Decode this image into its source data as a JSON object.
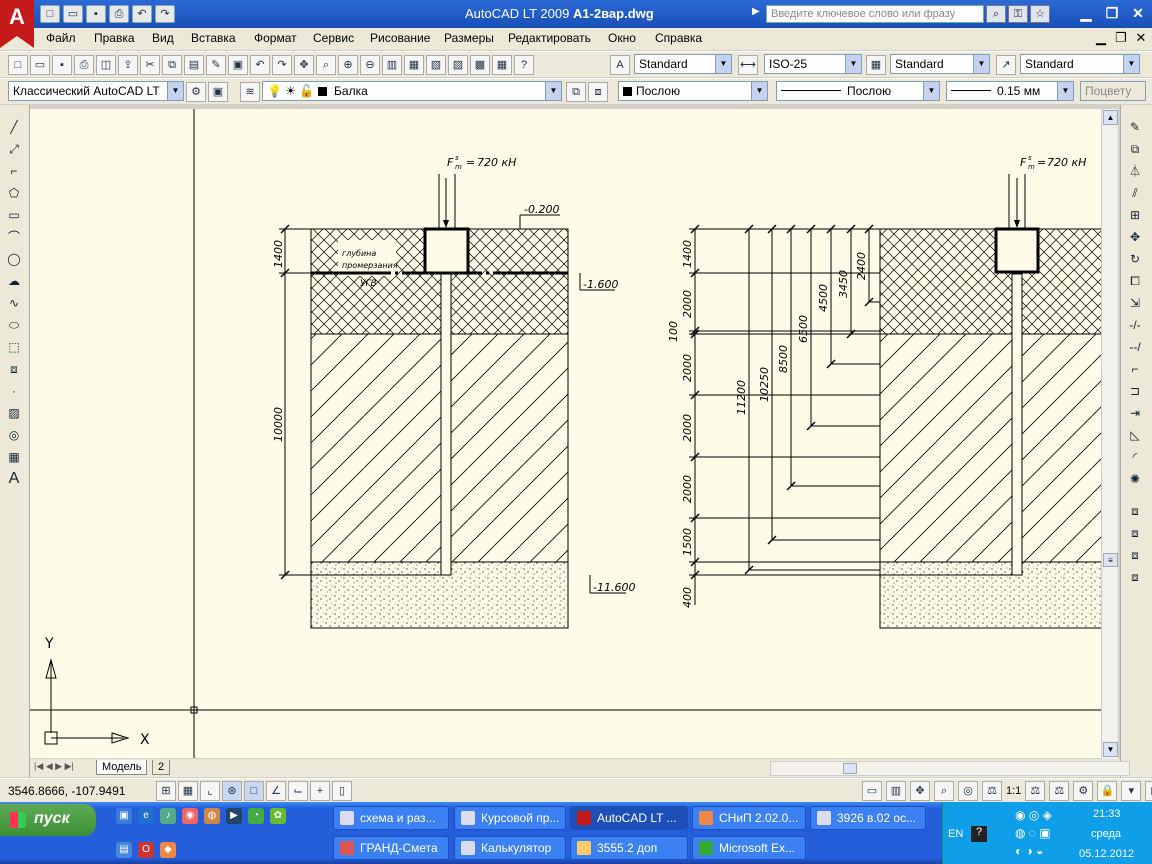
{
  "window": {
    "app_title": "AutoCAD LT 2009",
    "file_name": "A1-2вар.dwg",
    "search_placeholder": "Введите ключевое слово или фразу"
  },
  "menu": [
    "Файл",
    "Правка",
    "Вид",
    "Вставка",
    "Формат",
    "Сервис",
    "Рисование",
    "Размеры",
    "Редактировать",
    "Окно",
    "Справка"
  ],
  "styles_toolbar": {
    "text_style": "Standard",
    "dim_style": "ISO-25",
    "table_style": "Standard",
    "multileader_style": "Standard"
  },
  "layers_toolbar": {
    "workspace": "Классический AutoCAD LT",
    "layer": "Балка",
    "color": "Послою",
    "linetype": "Послою",
    "lineweight": "0.15 мм",
    "plot_style": "Поцвету"
  },
  "drawing": {
    "load_label_left": "720 кН",
    "load_label_right": "720 кН",
    "load_symbol": "F",
    "load_super": "s",
    "load_sub": "m",
    "elev_top": "-0.200",
    "elev_ugv": "-1.600",
    "elev_bottom": "-11.600",
    "freeze_note_1": "глубина",
    "freeze_note_2": "промерзания",
    "ugv_label": "УГВ",
    "dim_left_1400": "1400",
    "dim_left_10000": "10000",
    "right_dims_vertical": [
      "1400",
      "2000",
      "100",
      "2000",
      "2000",
      "2000",
      "1500",
      "400"
    ],
    "right_dims_cumulative": [
      "11200",
      "10250",
      "8500",
      "6500",
      "4500",
      "3450",
      "2400"
    ],
    "ucs_y": "Y",
    "ucs_x": "X"
  },
  "layout_tabs": [
    "Модель",
    "2"
  ],
  "status": {
    "coordinates": "3546.8666, -107.9491",
    "annotation_scale": "1:1"
  },
  "taskbar": {
    "start_label": "пуск",
    "tasks_row1": [
      "схема и раз...",
      "Курсовой пр...",
      "AutoCAD LT ...",
      "СНиП 2.02.0...",
      "3926 в.02 ос..."
    ],
    "tasks_row2": [
      "ГРАНД-Смета",
      "Калькулятор",
      "3555.2   доп",
      "Microsoft Ex..."
    ],
    "language": "EN",
    "time": "21:33",
    "weekday": "среда",
    "date": "05.12.2012"
  }
}
